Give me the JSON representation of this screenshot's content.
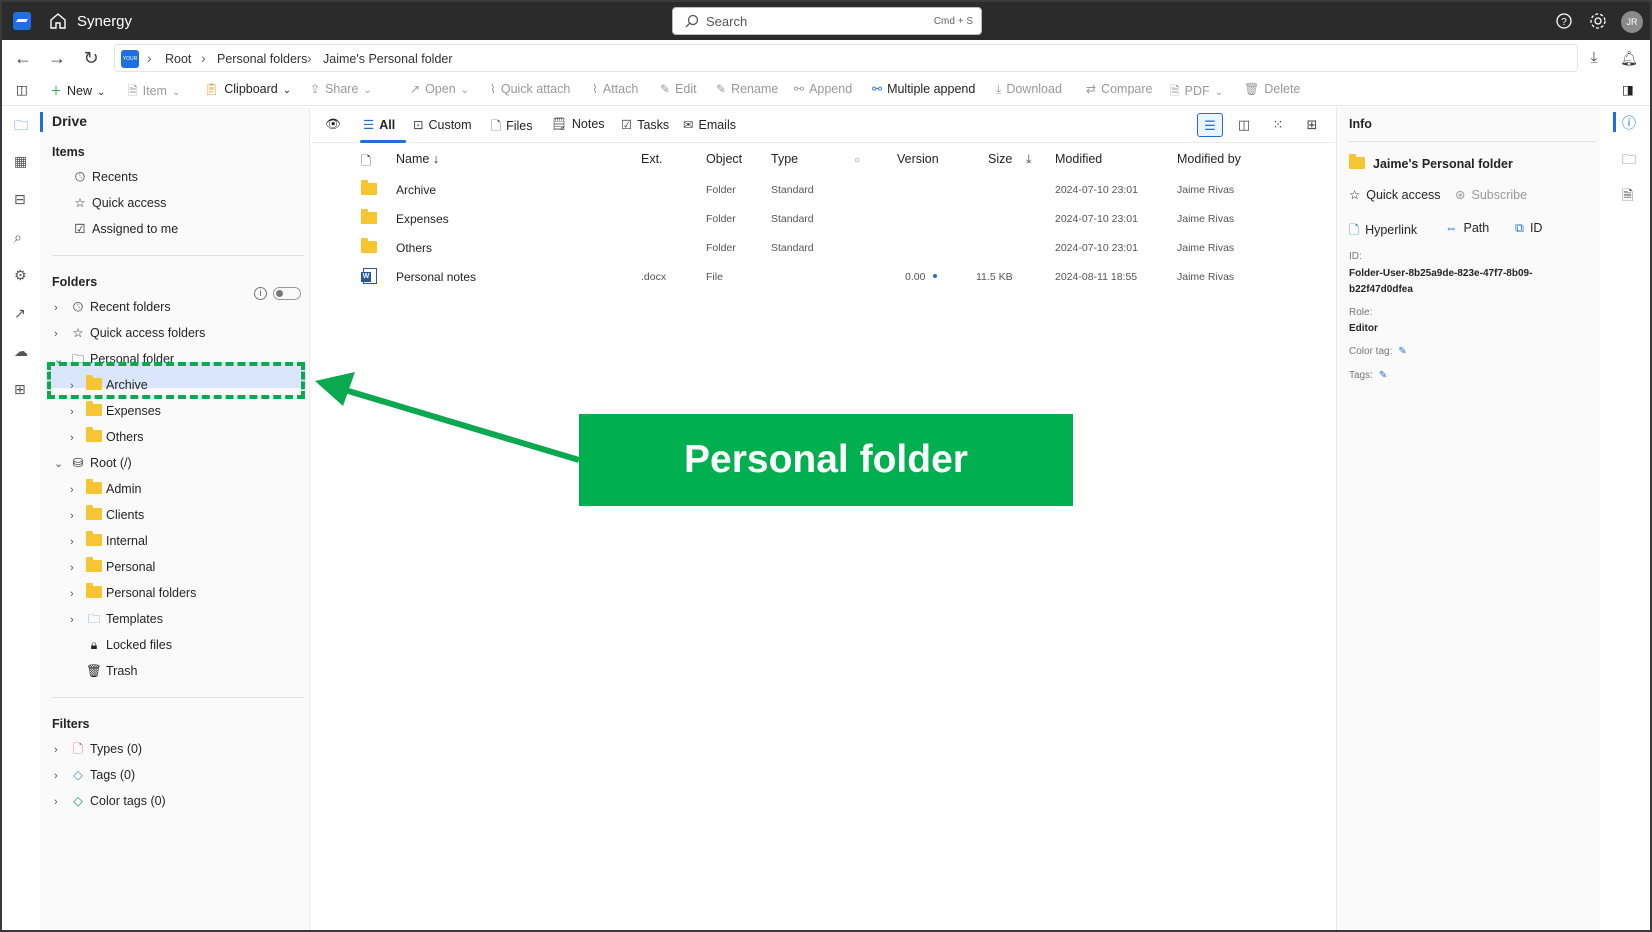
{
  "app": {
    "name": "Synergy",
    "avatar_initials": "JR"
  },
  "search": {
    "placeholder": "Search",
    "shortcut": "Cmd + S"
  },
  "breadcrumb": {
    "logo_text": "YOUR LOGO",
    "items": [
      "Root",
      "Personal folders",
      "Jaime's Personal folder"
    ]
  },
  "toolbar": {
    "new": "New",
    "item": "Item",
    "clipboard": "Clipboard",
    "share": "Share",
    "open": "Open",
    "quick_attach": "Quick attach",
    "attach": "Attach",
    "edit": "Edit",
    "rename": "Rename",
    "append": "Append",
    "multiple_append": "Multiple append",
    "download": "Download",
    "compare": "Compare",
    "pdf": "PDF",
    "delete": "Delete"
  },
  "sidebar": {
    "title": "Drive",
    "items_heading": "Items",
    "items": [
      "Recents",
      "Quick access",
      "Assigned to me"
    ],
    "folders_heading": "Folders",
    "folders": [
      "Recent folders",
      "Quick access folders",
      "Personal folder"
    ],
    "personal_children": [
      "Archive",
      "Expenses",
      "Others"
    ],
    "root_label": "Root (/)",
    "root_children": [
      "Admin",
      "Clients",
      "Internal",
      "Personal",
      "Personal folders",
      "Templates",
      "Locked files",
      "Trash"
    ],
    "filters_heading": "Filters",
    "filters": [
      "Types (0)",
      "Tags (0)",
      "Color tags (0)"
    ]
  },
  "tabs": [
    "All",
    "Custom",
    "Files",
    "Notes",
    "Tasks",
    "Emails"
  ],
  "columns": {
    "name": "Name ↓",
    "ext": "Ext.",
    "object": "Object",
    "type": "Type",
    "version": "Version",
    "size": "Size",
    "modified": "Modified",
    "modified_by": "Modified by"
  },
  "rows": [
    {
      "name": "Archive",
      "ext": "",
      "object": "Folder",
      "type": "Standard",
      "version": "",
      "size": "",
      "modified": "2024-07-10 23:01",
      "modified_by": "Jaime Rivas"
    },
    {
      "name": "Expenses",
      "ext": "",
      "object": "Folder",
      "type": "Standard",
      "version": "",
      "size": "",
      "modified": "2024-07-10 23:01",
      "modified_by": "Jaime Rivas"
    },
    {
      "name": "Others",
      "ext": "",
      "object": "Folder",
      "type": "Standard",
      "version": "",
      "size": "",
      "modified": "2024-07-10 23:01",
      "modified_by": "Jaime Rivas"
    },
    {
      "name": "Personal notes",
      "ext": ".docx",
      "object": "File",
      "type": "",
      "version": "0.00",
      "size": "11.5 KB",
      "modified": "2024-08-11 18:55",
      "modified_by": "Jaime Rivas"
    }
  ],
  "info": {
    "title": "Info",
    "folder_name": "Jaime's Personal folder",
    "quick_access": "Quick access",
    "subscribe": "Subscribe",
    "hyperlink": "Hyperlink",
    "path": "Path",
    "id_button": "ID",
    "id_label": "ID:",
    "id_value_1": "Folder-User-8b25a9de-823e-47f7-8b09-",
    "id_value_2": "b22f47d0dfea",
    "role_label": "Role:",
    "role_value": "Editor",
    "color_tag_label": "Color tag:",
    "tags_label": "Tags:"
  },
  "annotation": {
    "callout_text": "Personal folder",
    "color": "#00b050"
  }
}
